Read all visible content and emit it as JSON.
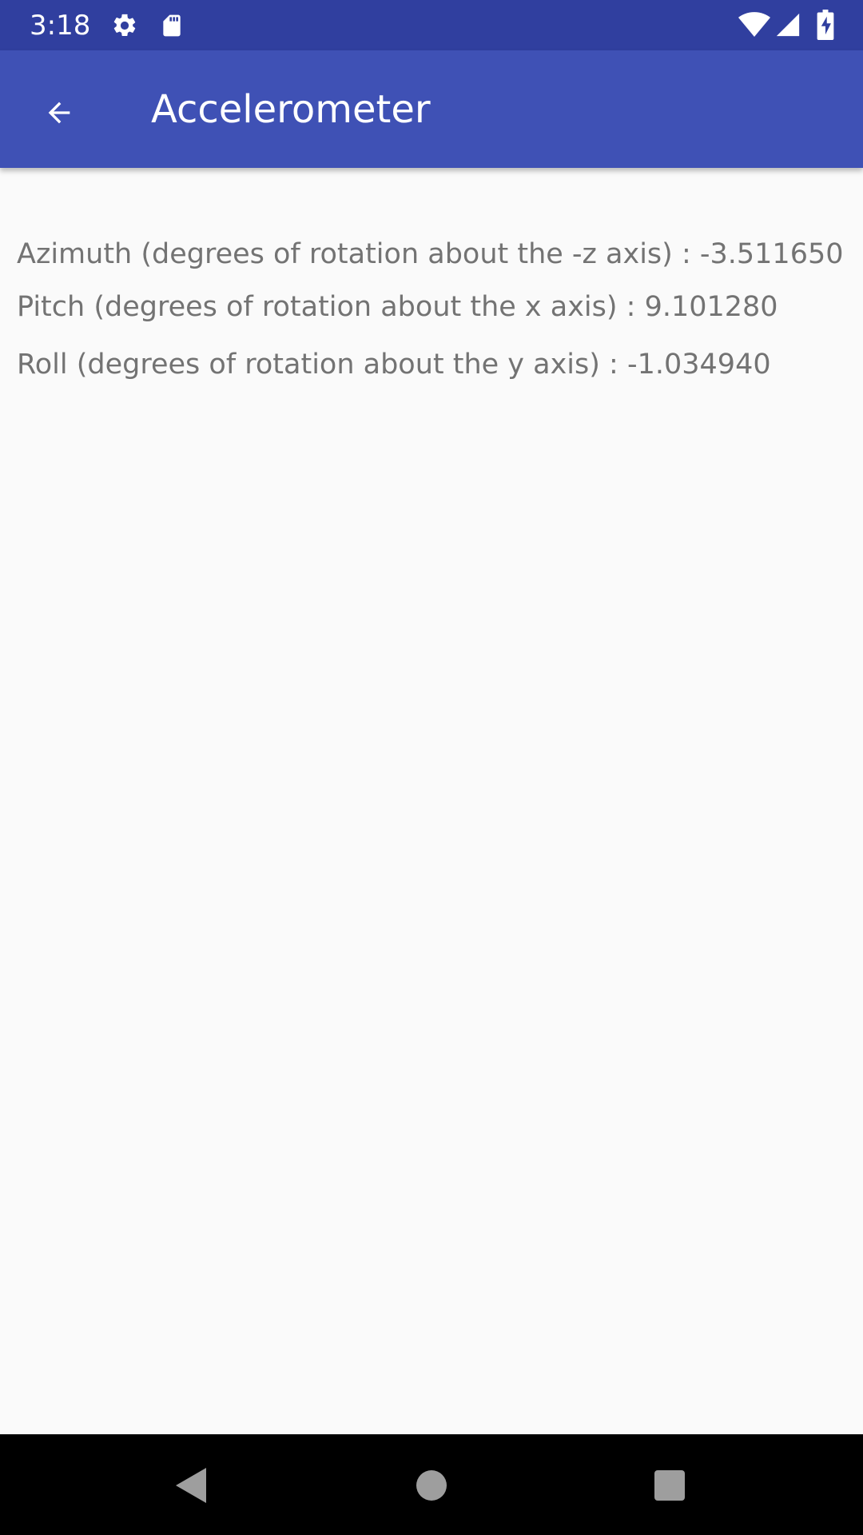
{
  "status_bar": {
    "time": "3:18",
    "background": "#303F9F",
    "icons": [
      "gear-icon",
      "sd-card-icon",
      "wifi-icon",
      "cell-signal-icon",
      "battery-charging-icon"
    ]
  },
  "toolbar": {
    "title": "Accelerometer",
    "background": "#3F51B5",
    "back_icon": "arrow-back-icon"
  },
  "readings": {
    "azimuth": "Azimuth (degrees of rotation about the -z axis) : -3.511650",
    "pitch": "Pitch (degrees of rotation about the x axis) : 9.101280",
    "roll": "Roll (degrees of rotation about the y axis) : -1.034940"
  },
  "nav_bar": {
    "buttons": [
      "back-triangle-icon",
      "home-circle-icon",
      "recents-square-icon"
    ]
  }
}
